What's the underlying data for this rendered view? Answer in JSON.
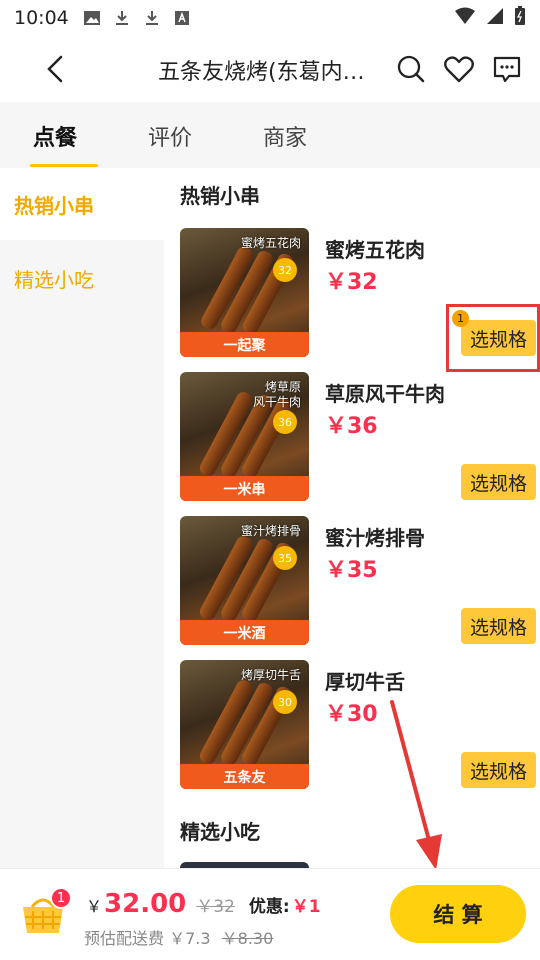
{
  "status": {
    "time": "10:04"
  },
  "nav": {
    "title": "五条友烧烤(东葛内…"
  },
  "tabs": [
    {
      "label": "点餐"
    },
    {
      "label": "评价"
    },
    {
      "label": "商家"
    }
  ],
  "sidebar": {
    "items": [
      {
        "label": "热销小串"
      },
      {
        "label": "精选小吃"
      }
    ]
  },
  "sections": [
    {
      "title": "热销小串"
    },
    {
      "title": "精选小吃"
    }
  ],
  "items": [
    {
      "name": "蜜烤五花肉",
      "price": "￥32",
      "button": "选规格",
      "thumb_tag": "蜜烤五花肉",
      "thumb_price": "32",
      "thumb_label": "一起聚"
    },
    {
      "name": "草原风干牛肉",
      "price": "￥36",
      "button": "选规格",
      "thumb_tag": "烤草原\n风干牛肉",
      "thumb_price": "36",
      "thumb_label": "一米串"
    },
    {
      "name": "蜜汁烤排骨",
      "price": "￥35",
      "button": "选规格",
      "thumb_tag": "蜜汁烤排骨",
      "thumb_price": "35",
      "thumb_label": "一米酒"
    },
    {
      "name": "厚切牛舌",
      "price": "￥30",
      "button": "选规格",
      "thumb_tag": "烤厚切牛舌",
      "thumb_price": "30",
      "thumb_label": "五条友"
    }
  ],
  "spec_badge": "1",
  "cart": {
    "badge": "1",
    "currency": "￥",
    "total": "32.00",
    "original": "￥32",
    "discount_label": "优惠:",
    "discount_value": "￥1",
    "delivery_label": "预估配送费",
    "delivery_fee": "￥7.3",
    "delivery_original": "￥8.30",
    "checkout": "结 算"
  },
  "colors": {
    "accent": "#ffc83a",
    "price": "#ff2f4f",
    "checkout": "#ffd00d",
    "highlight": "#e53935"
  }
}
